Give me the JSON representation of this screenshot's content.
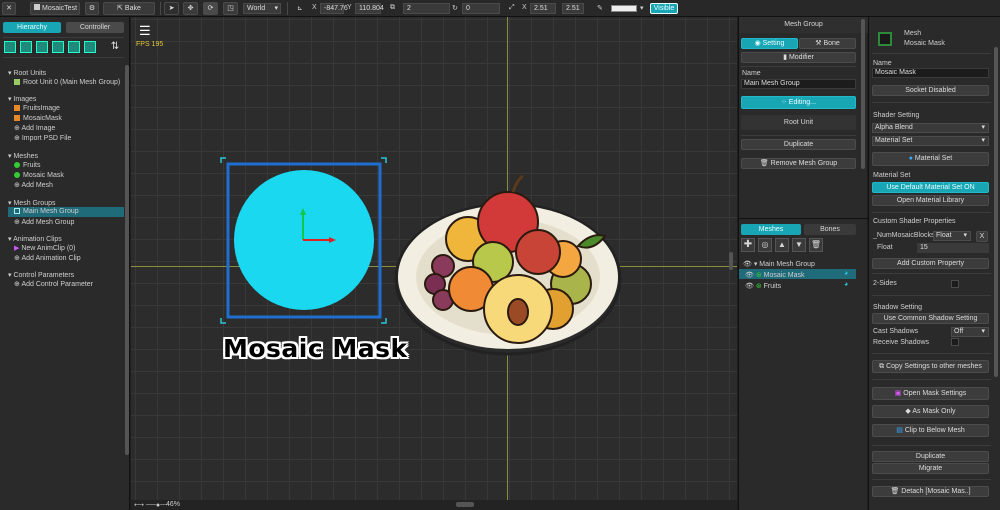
{
  "toolbar": {
    "project_name": "MosaicTest",
    "bake_label": "Bake",
    "space_option": "World",
    "x_label": "X",
    "x_value": "-847.76",
    "y_label": "Y",
    "y_value": "110.804",
    "depth_value": "2",
    "rotation_value": "0",
    "scale_x_label": "X",
    "scale_x_value": "2.51",
    "scale_y_value": "2.51",
    "visible_label": "Visible"
  },
  "left_panel": {
    "tab_hierarchy": "Hierarchy",
    "tab_controller": "Controller",
    "sections": {
      "root_units": "Root Units",
      "root_unit_item": "Root Unit 0 (Main Mesh Group)",
      "images": "Images",
      "fruits_image": "FruitsImage",
      "mosaic_mask_image": "MosaicMask",
      "add_image": "Add Image",
      "import_psd": "Import PSD File",
      "meshes": "Meshes",
      "mesh_fruits": "Fruits",
      "mesh_mosaic_mask": "Mosaic Mask",
      "add_mesh": "Add Mesh",
      "mesh_groups": "Mesh Groups",
      "main_mesh_group": "Main Mesh Group",
      "add_mesh_group": "Add Mesh Group",
      "animation_clips": "Animation Clips",
      "new_anim_clip": "New AnimClip  (0)",
      "add_animation_clip": "Add Animation Clip",
      "control_parameters": "Control Parameters",
      "add_control_parameter": "Add Control Parameter"
    }
  },
  "viewport": {
    "fps": "FPS 195",
    "caption": "Mosaic Mask",
    "zoom": "46%"
  },
  "mid_panel": {
    "title": "Mesh Group",
    "tab_setting": "Setting",
    "tab_bone": "Bone",
    "modifier_label": "Modifier",
    "name_label": "Name",
    "name_value": "Main Mesh Group",
    "editing_label": "Editing...",
    "root_unit_label": "Root Unit",
    "duplicate_label": "Duplicate",
    "remove_label": "Remove Mesh Group",
    "tab_meshes": "Meshes",
    "tab_bones": "Bones",
    "list_group": "Main Mesh Group",
    "list_mosaic": "Mosaic Mask",
    "list_fruits": "Fruits"
  },
  "right_panel": {
    "type_label": "Mesh",
    "object_name": "Mosaic Mask",
    "name_label": "Name",
    "name_value": "Mosaic Mask",
    "socket_label": "Socket Disabled",
    "shader_setting_label": "Shader Setting",
    "blend_mode": "Alpha Blend",
    "material_option": "Material Set",
    "material_set_button": "Material Set",
    "material_set_label": "Material Set",
    "use_default_material": "Use Default Material Set ON",
    "open_material_library": "Open Material Library",
    "custom_shader_label": "Custom Shader Properties",
    "prop_name": "_NumMosaicBlocks",
    "prop_type": "Float",
    "prop_remove": "X",
    "float_label": "Float",
    "float_value": "15",
    "add_custom_property": "Add Custom Property",
    "two_sides_label": "2-Sides",
    "shadow_setting_label": "Shadow Setting",
    "use_common_shadow": "Use Common Shadow Setting",
    "cast_shadows_label": "Cast Shadows",
    "cast_shadows_value": "Off",
    "receive_shadows_label": "Receive Shadows",
    "copy_settings": "Copy Settings to other meshes",
    "open_mask_settings": "Open Mask Settings",
    "as_mask_only": "As Mask Only",
    "clip_to_below": "Clip to Below Mesh",
    "duplicate": "Duplicate",
    "migrate": "Migrate",
    "detach": "Detach [Mosaic Mas..]"
  },
  "colors": {
    "accent_teal": "#18a6b5",
    "mask_cyan": "#19d8f0",
    "selection_blue": "#1e6fd0"
  }
}
